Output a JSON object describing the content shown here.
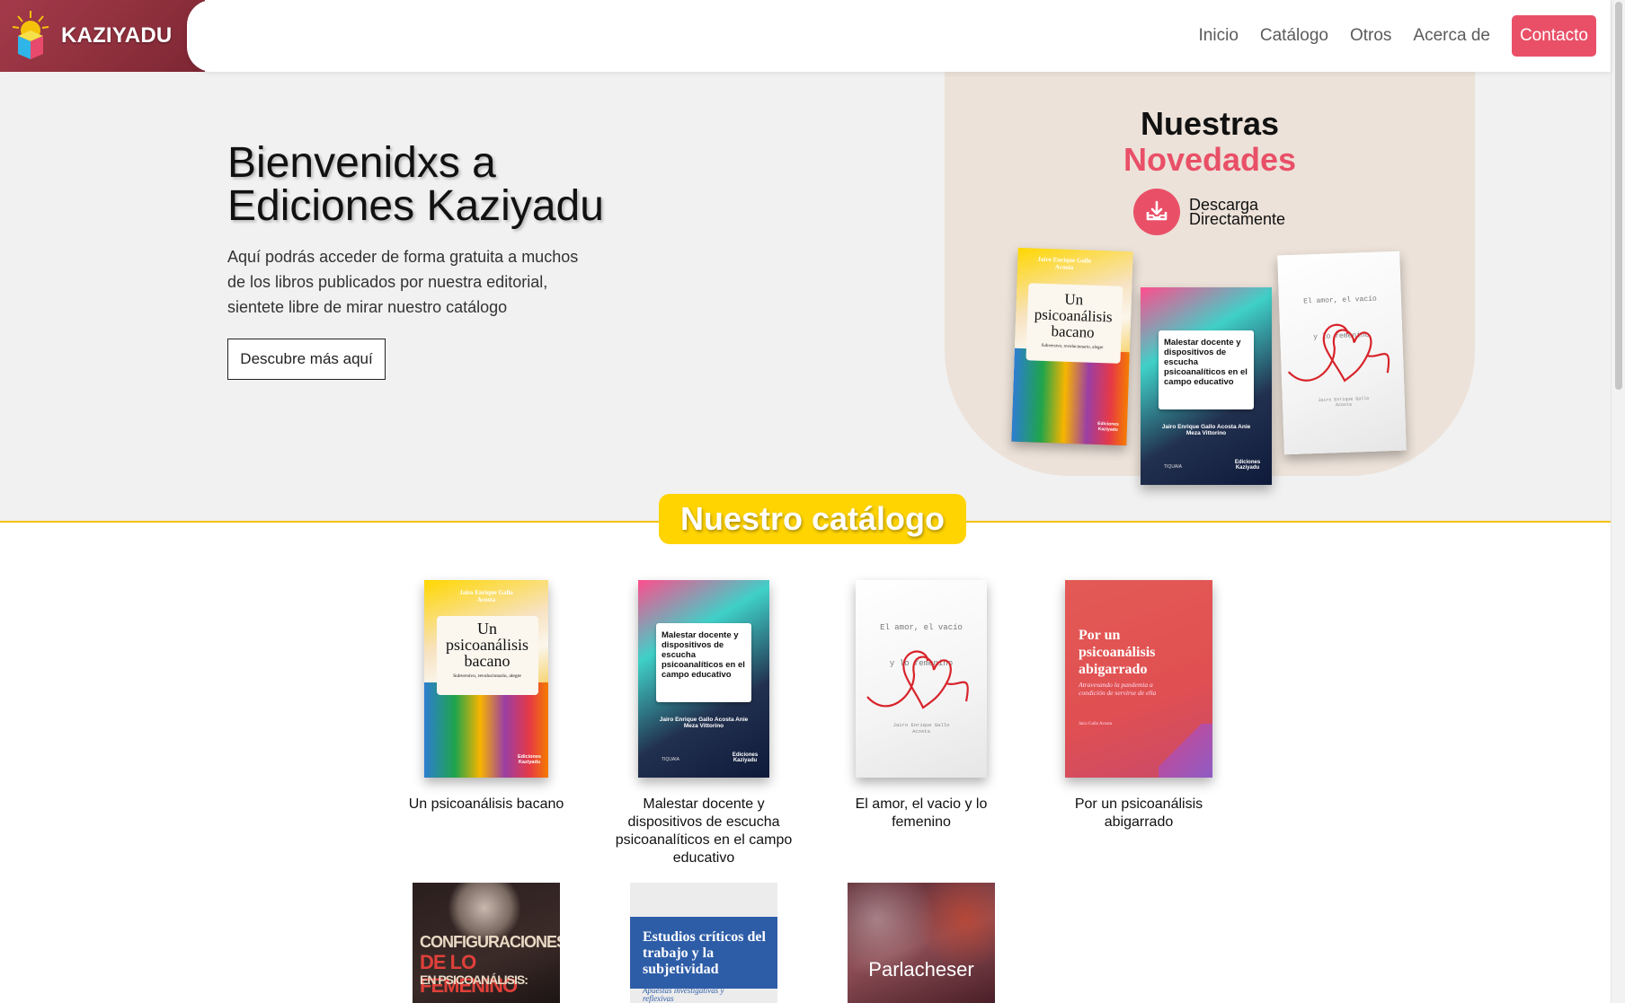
{
  "brand": {
    "name": "KAZIYADU",
    "logo_icon": "kaziyadu-logo-icon"
  },
  "nav": {
    "items": [
      {
        "label": "Inicio"
      },
      {
        "label": "Catálogo"
      },
      {
        "label": "Otros"
      },
      {
        "label": "Acerca de"
      }
    ],
    "contact_label": "Contacto"
  },
  "hero": {
    "title_line1": "Bienvenidxs a",
    "title_line2": "Ediciones Kaziyadu",
    "subtitle": "Aquí podrás acceder de forma gratuita a muchos de los libros publicados por nuestra editorial, sientete libre de mirar nuestro catálogo",
    "cta_label": "Descubre más aquí"
  },
  "novedades": {
    "title_line1": "Nuestras",
    "title_line2": "Novedades",
    "download_line1": "Descarga",
    "download_line2": "Directamente",
    "download_icon": "download-tray-icon"
  },
  "catalog": {
    "title": "Nuestro catálogo",
    "books": [
      {
        "title": "Un psicoanálisis bacano"
      },
      {
        "title": "Malestar docente y dispositivos de escucha psicoanalíticos en el campo educativo"
      },
      {
        "title": "El amor, el vacio y lo femenino"
      },
      {
        "title": "Por un psicoanálisis abigarrado"
      }
    ]
  },
  "covers": {
    "c1": {
      "author": "Jairo Enrique Gallo Acosta",
      "title_l1": "Un",
      "title_l2": "psicoanálisis",
      "title_l3": "bacano",
      "sub": "Subversivo, revolucionario, alegre",
      "publisher": "Ediciones Kaziyadu"
    },
    "c2": {
      "title": "Malestar docente y dispositivos de escucha psicoanalíticos en el campo educativo",
      "authors": "Jairo Enrique Gallo Acosta Anie Meza Vittorino",
      "imprint": "TIQUAIA",
      "publisher": "Ediciones Kaziyadu"
    },
    "c3": {
      "line1": "El amor, el vacío",
      "line2": "y lo femenino",
      "author": "Jairo Enrique Gallo Acosta"
    },
    "c4": {
      "title": "Por un psicoanálisis abigarrado",
      "sub": "Atravesando la pandemia a condición de servirse de ella",
      "author": "Jairo Gallo Acosta"
    },
    "c5": {
      "line1": "CONFIGURACIONES",
      "line2": "DE LO FEMENINO",
      "line3": "EN PSICOANÁLISIS:"
    },
    "c6": {
      "title": "Estudios críticos del trabajo y la subjetividad",
      "sub": "Apuestas investigativas y reflexivas"
    },
    "c7": {
      "title": "Parlacheser"
    }
  },
  "colors": {
    "accent": "#e95068",
    "catalog_yellow": "#ffd400",
    "logo_bg": "#a33a4b"
  }
}
